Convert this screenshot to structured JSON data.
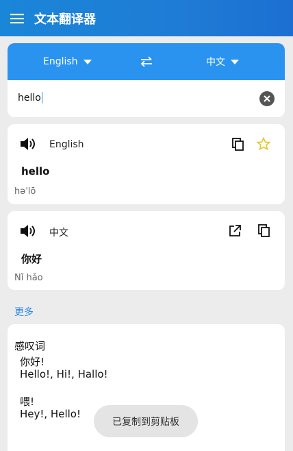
{
  "app": {
    "title": "文本翻译器"
  },
  "language_bar": {
    "source": "English",
    "target": "中文"
  },
  "input": {
    "value": "hello"
  },
  "source_card": {
    "language": "English",
    "word": "hello",
    "phonetic": "həˈlō"
  },
  "target_card": {
    "language": "中文",
    "word": "你好",
    "phonetic": "Nǐ hǎo"
  },
  "more_label": "更多",
  "dictionary": {
    "part_of_speech": "感叹词",
    "entries": [
      {
        "word": "你好!",
        "translations": "Hello!, Hi!, Hallo!"
      },
      {
        "word": "喂!",
        "translations": "Hey!, Hello!"
      }
    ]
  },
  "toast": "已复制到剪贴板",
  "colors": {
    "app_bar": "#1f7cd6",
    "language_bar": "#2a93f0",
    "link": "#2a8be0",
    "star": "#e8c21e"
  },
  "icons": [
    "menu-icon",
    "caret-down-icon",
    "swap-icon",
    "clear-icon",
    "speaker-icon",
    "copy-icon",
    "star-icon",
    "open-external-icon"
  ]
}
